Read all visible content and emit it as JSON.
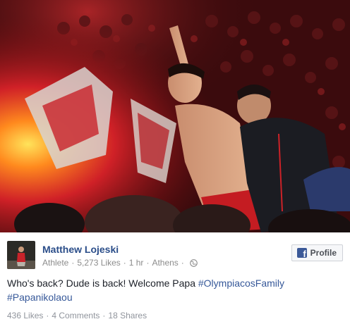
{
  "post": {
    "page_name": "Matthew Lojeski",
    "category": "Athlete",
    "likes_label": "5,273 Likes",
    "time": "1 hr",
    "location": "Athens",
    "separator": "·",
    "privacy_icon": "globe-icon",
    "profile_button_label": "Profile",
    "profile_button_icon": "facebook-f-icon",
    "text_before": "Who's back? Dude is back! Welcome Papa ",
    "hashtag_1": "#OlympiacosFamily",
    "text_between": " ",
    "hashtag_2": "#Papanikolaou",
    "image_description_icon": "photo"
  },
  "stats": {
    "likes": "436 Likes",
    "comments": "4 Comments",
    "shares": "18 Shares",
    "separator": "·"
  },
  "colors": {
    "name_link": "#2a4d89",
    "hashtag": "#365899",
    "meta_text": "#8c8c8c",
    "body_text": "#1d2129",
    "facebook_blue": "#3b5998",
    "flare_red": "#e0232a"
  }
}
